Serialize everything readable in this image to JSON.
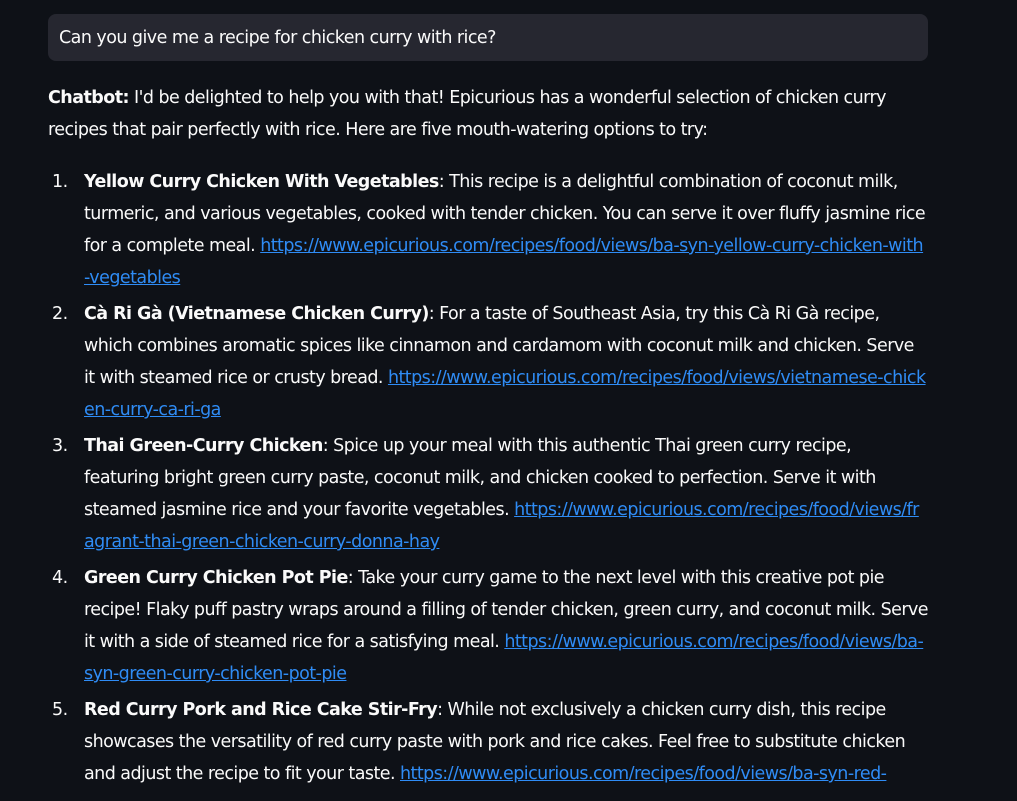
{
  "user_message": "Can you give me a recipe for chicken curry with rice?",
  "reply": {
    "speaker": "Chatbot:",
    "intro": " I'd be delighted to help you with that! Epicurious has a wonderful selection of chicken curry recipes that pair perfectly with rice. Here are five mouth-watering options to try:",
    "items": [
      {
        "number": "1.",
        "title": "Yellow Curry Chicken With Vegetables",
        "text": ": This recipe is a delightful combination of coconut milk, turmeric, and various vegetables, cooked with tender chicken. You can serve it over fluffy jasmine rice for a complete meal. ",
        "url": "https://www.epicurious.com/recipes/food/views/ba-syn-yellow-curry-chicken-with-vegetables"
      },
      {
        "number": "2.",
        "title": "Cà Ri Gà (Vietnamese Chicken Curry)",
        "text": ": For a taste of Southeast Asia, try this Cà Ri Gà recipe, which combines aromatic spices like cinnamon and cardamom with coconut milk and chicken. Serve it with steamed rice or crusty bread. ",
        "url": "https://www.epicurious.com/recipes/food/views/vietnamese-chicken-curry-ca-ri-ga"
      },
      {
        "number": "3.",
        "title": "Thai Green-Curry Chicken",
        "text": ": Spice up your meal with this authentic Thai green curry recipe, featuring bright green curry paste, coconut milk, and chicken cooked to perfection. Serve it with steamed jasmine rice and your favorite vegetables. ",
        "url": "https://www.epicurious.com/recipes/food/views/fragrant-thai-green-chicken-curry-donna-hay"
      },
      {
        "number": "4.",
        "title": "Green Curry Chicken Pot Pie",
        "text": ": Take your curry game to the next level with this creative pot pie recipe! Flaky puff pastry wraps around a filling of tender chicken, green curry, and coconut milk. Serve it with a side of steamed rice for a satisfying meal. ",
        "url": "https://www.epicurious.com/recipes/food/views/ba-syn-green-curry-chicken-pot-pie"
      },
      {
        "number": "5.",
        "title": "Red Curry Pork and Rice Cake Stir-Fry",
        "text": ": While not exclusively a chicken curry dish, this recipe showcases the versatility of red curry paste with pork and rice cakes. Feel free to substitute chicken and adjust the recipe to fit your taste. ",
        "url": "https://www.epicurious.com/recipes/food/views/ba-syn-red-"
      }
    ]
  },
  "colors": {
    "background": "#0e1117",
    "user_bubble": "#262730",
    "text": "#fafafa",
    "link": "#2f8cf5"
  }
}
